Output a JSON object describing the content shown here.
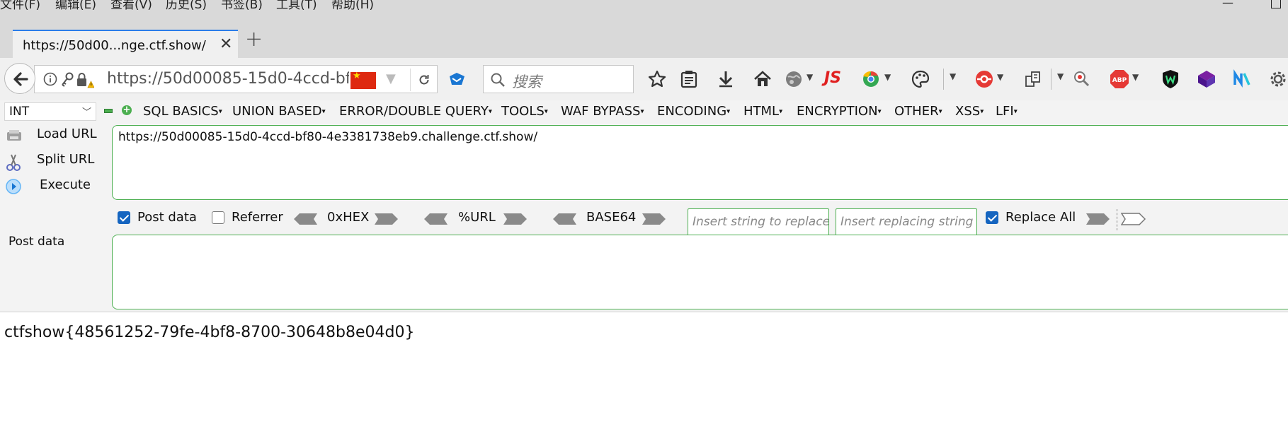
{
  "menubar": {
    "items": [
      "文件(F)",
      "编辑(E)",
      "查看(V)",
      "历史(S)",
      "书签(B)",
      "工具(T)",
      "帮助(H)"
    ]
  },
  "tab": {
    "title": "https://50d00...nge.ctf.show/",
    "close": "✕",
    "new_tab": "+"
  },
  "navbar": {
    "url": "https://50d00085-15d0-4ccd-bf80-4e3381738eb9.challenge.ctf.show/",
    "search_placeholder": "搜索",
    "icons": [
      "back-icon",
      "info-icon",
      "key-icon",
      "insecure-lock-icon",
      "china-flag-icon",
      "reload-icon",
      "pocket-icon",
      "search-icon",
      "bookmark-star-icon",
      "reader-icon",
      "download-icon",
      "home-icon",
      "globe-icon",
      "js-icon",
      "chrome-icon",
      "palette-icon",
      "lifebuoy-icon",
      "clipboard-icon",
      "zoom-icon",
      "adblock-icon",
      "shield-w-icon",
      "cube-icon",
      "n-logo-icon",
      "gear-icon"
    ],
    "js_label": "JS",
    "abp_label": "ABP",
    "accent_color": "#2b7de9"
  },
  "hackbar": {
    "select_value": "INT",
    "menus": [
      "SQL BASICS",
      "UNION BASED",
      "ERROR/DOUBLE QUERY",
      "TOOLS",
      "WAF BYPASS",
      "ENCODING",
      "HTML",
      "ENCRYPTION",
      "OTHER",
      "XSS",
      "LFI"
    ],
    "actions": {
      "load_url": "Load URL",
      "split_url": "Split URL",
      "execute": "Execute"
    },
    "url_value": "https://50d00085-15d0-4ccd-bf80-4e3381738eb9.challenge.ctf.show/",
    "options": {
      "post_data_label": "Post data",
      "post_data_checked": true,
      "referrer_label": "Referrer",
      "referrer_checked": false,
      "hex_label": "0xHEX",
      "url_label": "%URL",
      "base64_label": "BASE64",
      "replace_placeholder": "Insert string to replace",
      "replacing_placeholder": "Insert replacing string",
      "replace_all_label": "Replace All",
      "replace_all_checked": true
    },
    "post_label": "Post data",
    "post_value": "",
    "border_color": "#4caf50"
  },
  "page": {
    "content": "ctfshow{48561252-79fe-4bf8-8700-30648b8e04d0}"
  }
}
